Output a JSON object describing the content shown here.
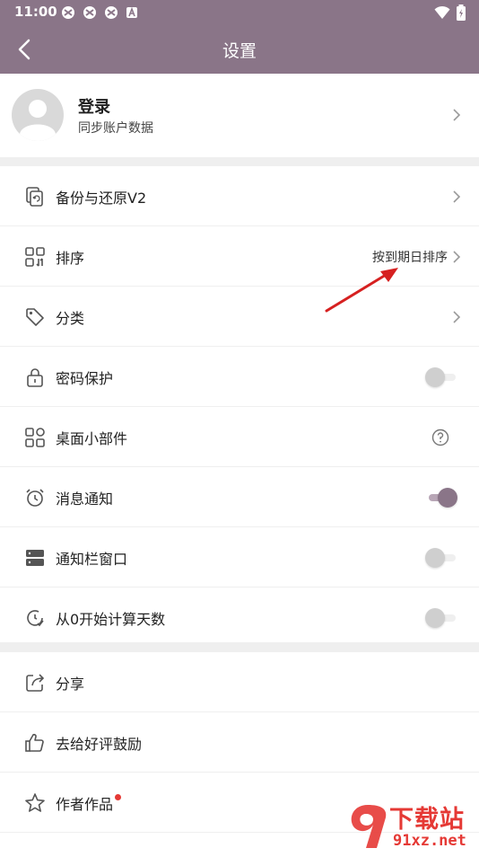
{
  "status": {
    "time": "11:00"
  },
  "header": {
    "title": "设置"
  },
  "profile": {
    "name": "登录",
    "subtitle": "同步账户数据"
  },
  "settings": [
    {
      "label": "备份与还原V2"
    },
    {
      "label": "排序",
      "value": "按到期日排序"
    },
    {
      "label": "分类"
    },
    {
      "label": "密码保护",
      "toggle": "off"
    },
    {
      "label": "桌面小部件"
    },
    {
      "label": "消息通知",
      "toggle": "on"
    },
    {
      "label": "通知栏窗口",
      "toggle": "off"
    },
    {
      "label": "从0开始计算天数",
      "toggle": "off"
    }
  ],
  "more": [
    {
      "label": "分享"
    },
    {
      "label": "去给好评鼓励"
    },
    {
      "label": "作者作品"
    }
  ],
  "watermark": {
    "logo": "下载站",
    "site": "91xz.net"
  },
  "colors": {
    "accent": "#8a7588",
    "toggle_on": "#8a7588",
    "dot": "#e53935",
    "arrow": "#d62020"
  }
}
